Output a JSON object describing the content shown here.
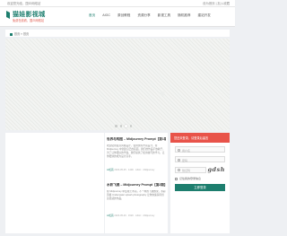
{
  "topbar": {
    "welcome": "欢迎您光临，国众网络站",
    "right": "设为首页 | 加入收藏"
  },
  "header": {
    "logo_title": "猫娃影视城",
    "logo_sub": "免费在线看，国众网络站",
    "nav": [
      "首页",
      "AIGC",
      "原创教程",
      "资源分享",
      "影视工具",
      "随机推荐",
      "建站开发"
    ]
  },
  "breadcrumb": {
    "home": "首页",
    "sep": "»",
    "current": "首页"
  },
  "articles": [
    {
      "title": "世界与构图 – Midjourney Prompt【第1期】",
      "excerpt": "欢迎使用发哥风格设计，使用国专学画设计，在 Midjourney 中创建自己的画面，我们的作品不依赖于，为了让你更好的学会，我们提供了使用技巧的学习，让你更快的成为设计高手。",
      "meta": "2023-05-25 · 1400 · AIGC · Midjourney",
      "tag": "AI绘画"
    },
    {
      "title": "水彩飞溅 – Midjourney Prompt【第2期】",
      "excerpt": "在 Midjourney 中生成艺术画，不一样的飞溅效果，水彩风格 Underwater splash photography 让你快速获得创意灵感的作品。",
      "meta": "2023-05-26 · 1520 · AIGC · Midjourney",
      "tag": "AI绘画"
    }
  ],
  "sidebar": {
    "header": "您还未登录，请登录后留言",
    "fields": [
      {
        "icon": "user-icon",
        "placeholder": "用户名"
      },
      {
        "icon": "lock-icon",
        "placeholder": "密码"
      }
    ],
    "captcha_placeholder": "验证码",
    "captcha_text": "gdsh",
    "remember_label": "记住我的登录信息",
    "login_button": "立即登录"
  },
  "colors": {
    "brand": "#1d7e6e",
    "accent": "#e8534a"
  }
}
